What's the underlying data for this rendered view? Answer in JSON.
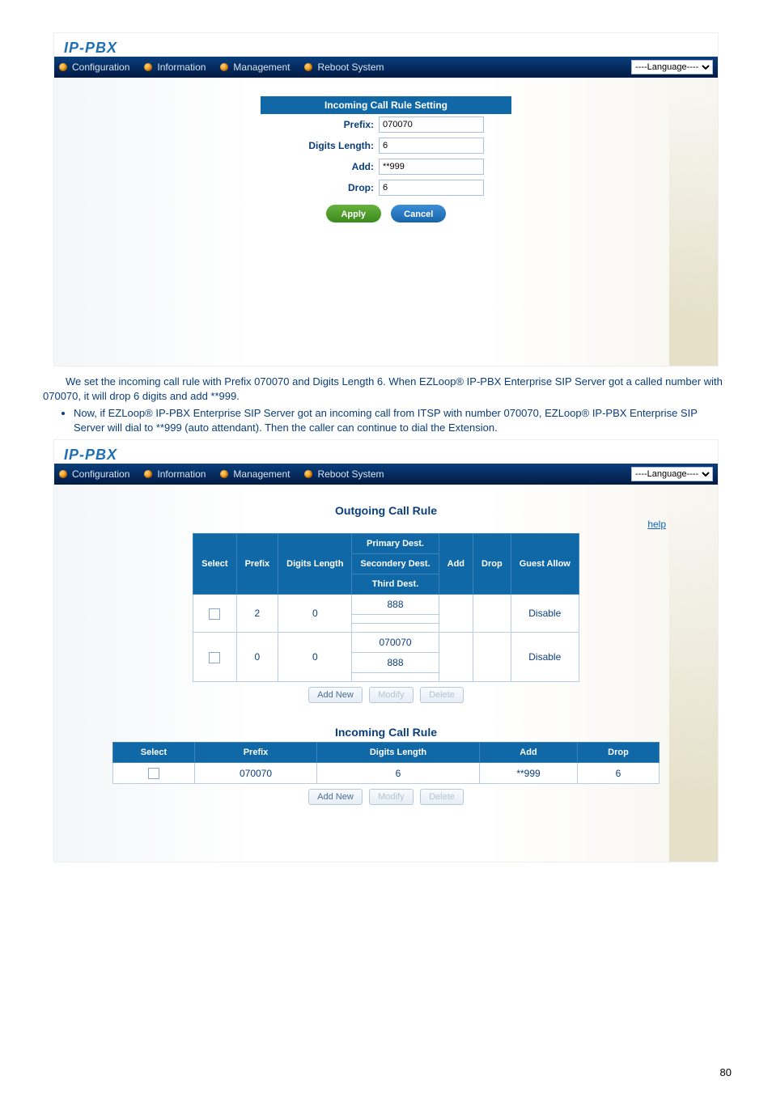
{
  "logo": "IP-PBX",
  "tabs": {
    "configuration": "Configuration",
    "information": "Information",
    "management": "Management",
    "reboot": "Reboot System"
  },
  "lang_placeholder": "----Language----",
  "incoming_form": {
    "title": "Incoming Call Rule Setting",
    "labels": {
      "prefix": "Prefix:",
      "digits_len": "Digits Length:",
      "add": "Add:",
      "drop": "Drop:"
    },
    "values": {
      "prefix": "070070",
      "digits_len": "6",
      "add": "**999",
      "drop": "6"
    },
    "buttons": {
      "apply": "Apply",
      "cancel": "Cancel"
    }
  },
  "narrative": {
    "line1": "We set the incoming call rule with Prefix 070070 and Digits Length 6. When EZLoop® IP-PBX Enterprise SIP Server got a called number with 070070, it will drop 6 digits and add **999.",
    "bullet1": "Now, if EZLoop® IP-PBX Enterprise SIP Server got an incoming call from ITSP with number 070070, EZLoop® IP-PBX Enterprise SIP Server will dial to **999 (auto attendant). Then the caller can continue to dial the Extension."
  },
  "outgoing": {
    "title": "Outgoing Call Rule",
    "help": "help",
    "headers": {
      "select": "Select",
      "prefix": "Prefix",
      "digits_len": "Digits Length",
      "primary": "Primary Dest.",
      "secondary": "Secondery Dest.",
      "third": "Third Dest.",
      "add": "Add",
      "drop": "Drop",
      "guest": "Guest Allow"
    },
    "rows": [
      {
        "prefix": "2",
        "digits_len": "0",
        "primary": "888",
        "secondary": "",
        "third": "",
        "add": "",
        "drop": "",
        "guest": "Disable"
      },
      {
        "prefix": "0",
        "digits_len": "0",
        "primary": "070070",
        "secondary": "888",
        "third": "",
        "add": "",
        "drop": "",
        "guest": "Disable"
      }
    ],
    "buttons": {
      "addnew": "Add New",
      "modify": "Modify",
      "delete": "Delete"
    }
  },
  "incoming_table": {
    "title": "Incoming Call Rule",
    "headers": {
      "select": "Select",
      "prefix": "Prefix",
      "digits_len": "Digits Length",
      "add": "Add",
      "drop": "Drop"
    },
    "rows": [
      {
        "prefix": "070070",
        "digits_len": "6",
        "add": "**999",
        "drop": "6"
      }
    ],
    "buttons": {
      "addnew": "Add New",
      "modify": "Modify",
      "delete": "Delete"
    }
  },
  "page_number": "80"
}
